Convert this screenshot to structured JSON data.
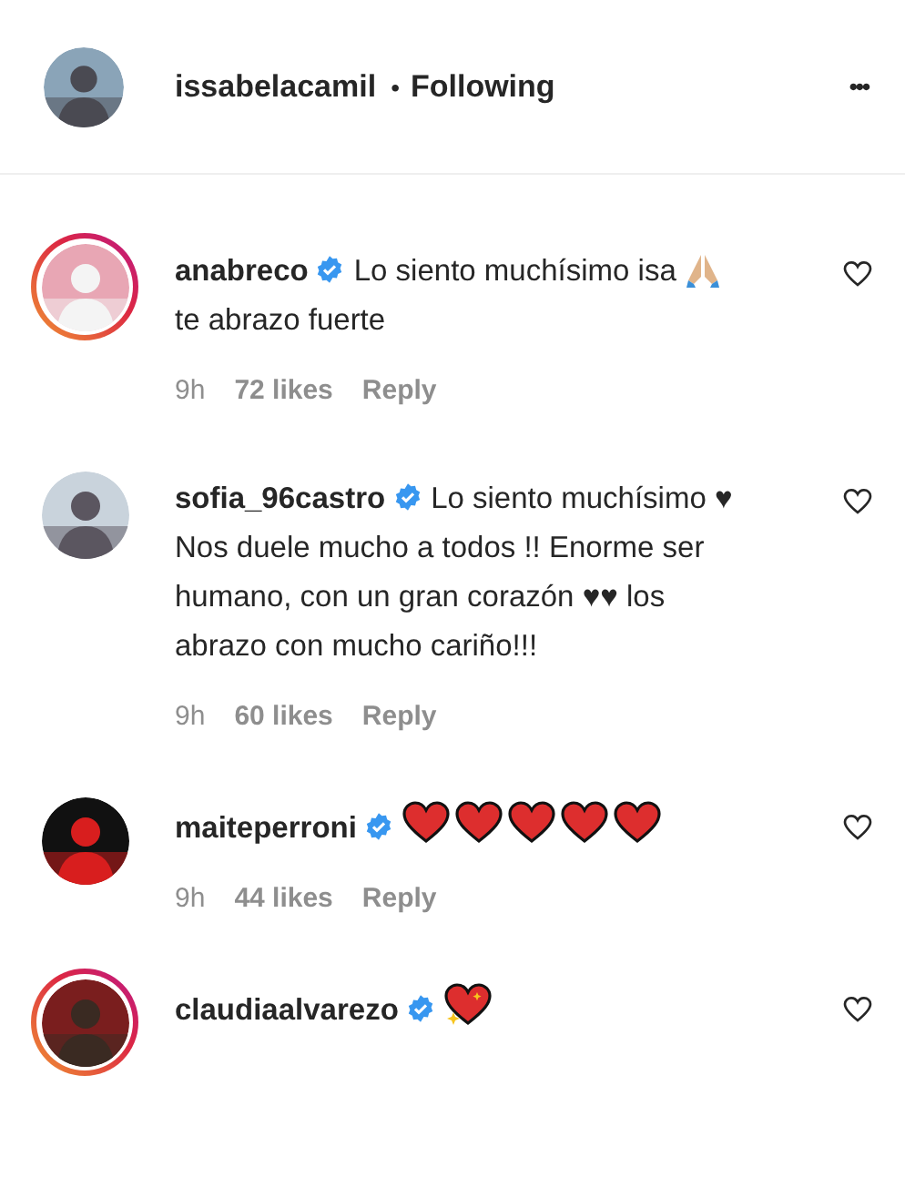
{
  "header": {
    "username": "issabelacamil",
    "separator": "•",
    "follow_status": "Following",
    "more": "•••"
  },
  "comments": [
    {
      "username": "anabreco",
      "verified": true,
      "story_ring": true,
      "segments": [
        {
          "kind": "text",
          "text": "Lo siento muchísimo isa"
        },
        {
          "kind": "pray"
        },
        {
          "kind": "text",
          "text": "te abrazo fuerte"
        }
      ],
      "time": "9h",
      "likes": "72 likes",
      "reply": "Reply",
      "liked": false
    },
    {
      "username": "sofia_96castro",
      "verified": true,
      "story_ring": false,
      "segments": [
        {
          "kind": "text",
          "text": "Lo siento muchísimo ♥ Nos duele mucho a todos !! Enorme ser humano, con un gran corazón ♥♥ los abrazo con mucho cariño!!!"
        }
      ],
      "time": "9h",
      "likes": "60 likes",
      "reply": "Reply",
      "liked": false
    },
    {
      "username": "maiteperroni",
      "verified": true,
      "story_ring": false,
      "segments": [
        {
          "kind": "heart"
        },
        {
          "kind": "heart"
        },
        {
          "kind": "heart"
        },
        {
          "kind": "heart"
        },
        {
          "kind": "heart"
        }
      ],
      "time": "9h",
      "likes": "44 likes",
      "reply": "Reply",
      "liked": false
    },
    {
      "username": "claudiaalvarezo",
      "verified": true,
      "story_ring": true,
      "segments": [
        {
          "kind": "sparkleheart"
        }
      ],
      "liked": false
    }
  ]
}
